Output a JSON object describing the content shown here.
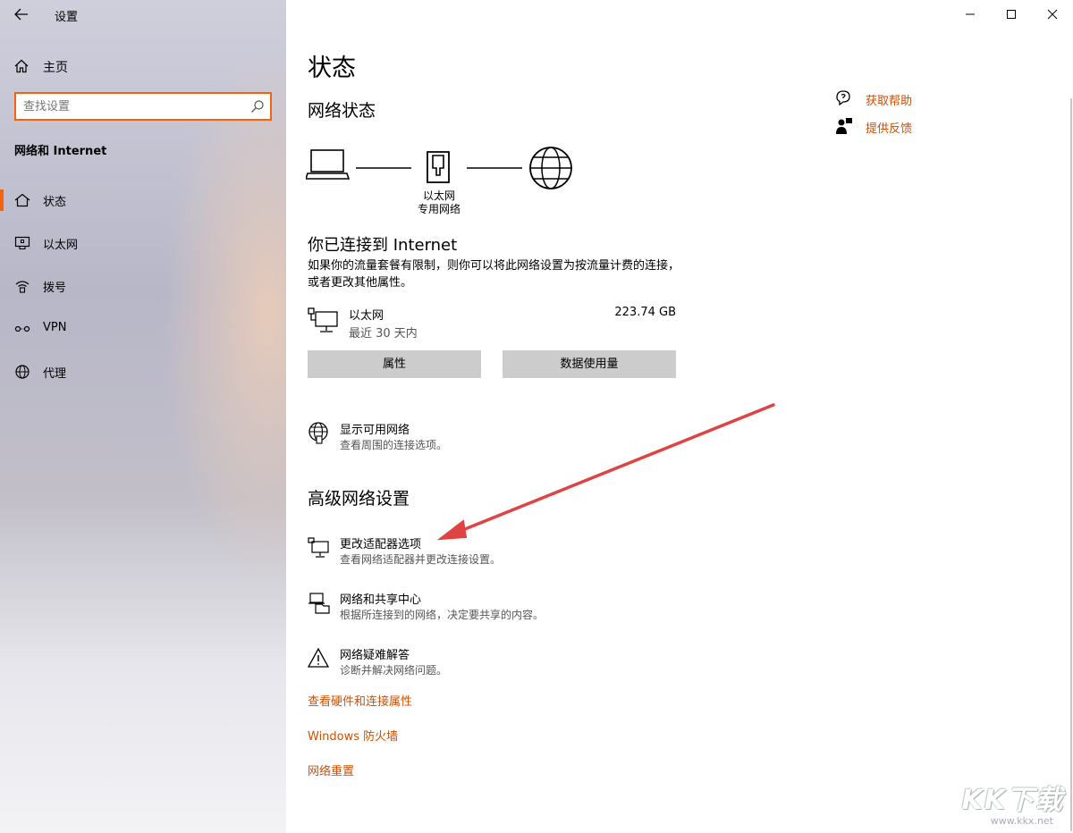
{
  "window": {
    "title": "设置"
  },
  "sidebar": {
    "home_label": "主页",
    "search_placeholder": "查找设置",
    "section_title": "网络和 Internet",
    "items": [
      {
        "label": "状态",
        "icon": "home-status-icon",
        "active": true
      },
      {
        "label": "以太网",
        "icon": "ethernet-icon",
        "active": false
      },
      {
        "label": "拨号",
        "icon": "dialup-icon",
        "active": false
      },
      {
        "label": "VPN",
        "icon": "vpn-icon",
        "active": false
      },
      {
        "label": "代理",
        "icon": "globe-icon",
        "active": false
      }
    ]
  },
  "main": {
    "page_title": "状态",
    "network_status_heading": "网络状态",
    "diagram": {
      "adapter_label_line1": "以太网",
      "adapter_label_line2": "专用网络"
    },
    "connected_title": "你已连接到 Internet",
    "connected_desc": "如果你的流量套餐有限制，则你可以将此网络设置为按流量计费的连接，或者更改其他属性。",
    "adapter": {
      "name": "以太网",
      "period": "最近 30 天内",
      "usage": "223.74 GB"
    },
    "buttons": {
      "properties": "属性",
      "data_usage": "数据使用量"
    },
    "show_networks": {
      "title": "显示可用网络",
      "desc": "查看周围的连接选项。"
    },
    "advanced_heading": "高级网络设置",
    "advanced_options": [
      {
        "title": "更改适配器选项",
        "desc": "查看网络适配器并更改连接设置。"
      },
      {
        "title": "网络和共享中心",
        "desc": "根据所连接到的网络，决定要共享的内容。"
      },
      {
        "title": "网络疑难解答",
        "desc": "诊断并解决网络问题。"
      }
    ],
    "links": {
      "hardware": "查看硬件和连接属性",
      "firewall": "Windows 防火墙",
      "reset": "网络重置"
    }
  },
  "help": {
    "get_help": "获取帮助",
    "feedback": "提供反馈"
  },
  "watermark": {
    "logo": "KK下载",
    "url": "www.kkx.net"
  },
  "colors": {
    "accent": "#f7630c",
    "link": "#d24e00",
    "arrow": "#e04343"
  }
}
